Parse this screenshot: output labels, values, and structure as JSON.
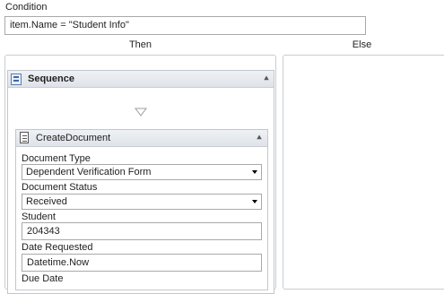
{
  "condition": {
    "label": "Condition",
    "expression": "item.Name  = \"Student Info\""
  },
  "branches": {
    "then_label": "Then",
    "else_label": "Else"
  },
  "sequence": {
    "title": "Sequence",
    "icon": "sequence-icon"
  },
  "create_document": {
    "title": "CreateDocument",
    "icon": "document-icon",
    "document_type": {
      "label": "Document Type",
      "value": "Dependent Verification Form"
    },
    "document_status": {
      "label": "Document Status",
      "value": "Received"
    },
    "student": {
      "label": "Student",
      "value": "204343"
    },
    "date_requested": {
      "label": "Date Requested",
      "value": "Datetime.Now"
    },
    "due_date": {
      "label": "Due Date"
    }
  }
}
